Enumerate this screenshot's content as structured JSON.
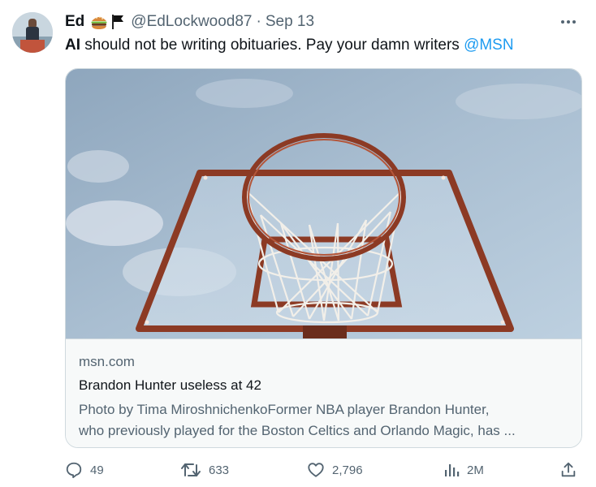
{
  "author": {
    "name": "Ed",
    "handle": "@EdLockwood87",
    "separator": "·",
    "date": "Sep 13",
    "badges": [
      "burger-emoji",
      "black-flag-emoji"
    ]
  },
  "tweet": {
    "lead": "AI",
    "body": " should not be writing obituaries. Pay your damn writers ",
    "mention": "@MSN"
  },
  "card": {
    "domain": "msn.com",
    "title": "Brandon Hunter useless at 42",
    "description_line1": "Photo by Tima MiroshnichenkoFormer NBA player Brandon Hunter,",
    "description_line2": "who previously played for the Boston Celtics and Orlando Magic, has ...",
    "image": "basketball-hoop-photo"
  },
  "actions": {
    "replies": {
      "icon": "reply-icon",
      "count": "49"
    },
    "reposts": {
      "icon": "repost-icon",
      "count": "633"
    },
    "likes": {
      "icon": "heart-icon",
      "count": "2,796"
    },
    "views": {
      "icon": "views-icon",
      "count": "2M"
    },
    "share": {
      "icon": "share-icon"
    }
  },
  "colors": {
    "text": "#0f1419",
    "muted": "#536471",
    "link": "#1d9bf0",
    "border": "#cfd9de",
    "card_bg": "#f7f9f9"
  }
}
